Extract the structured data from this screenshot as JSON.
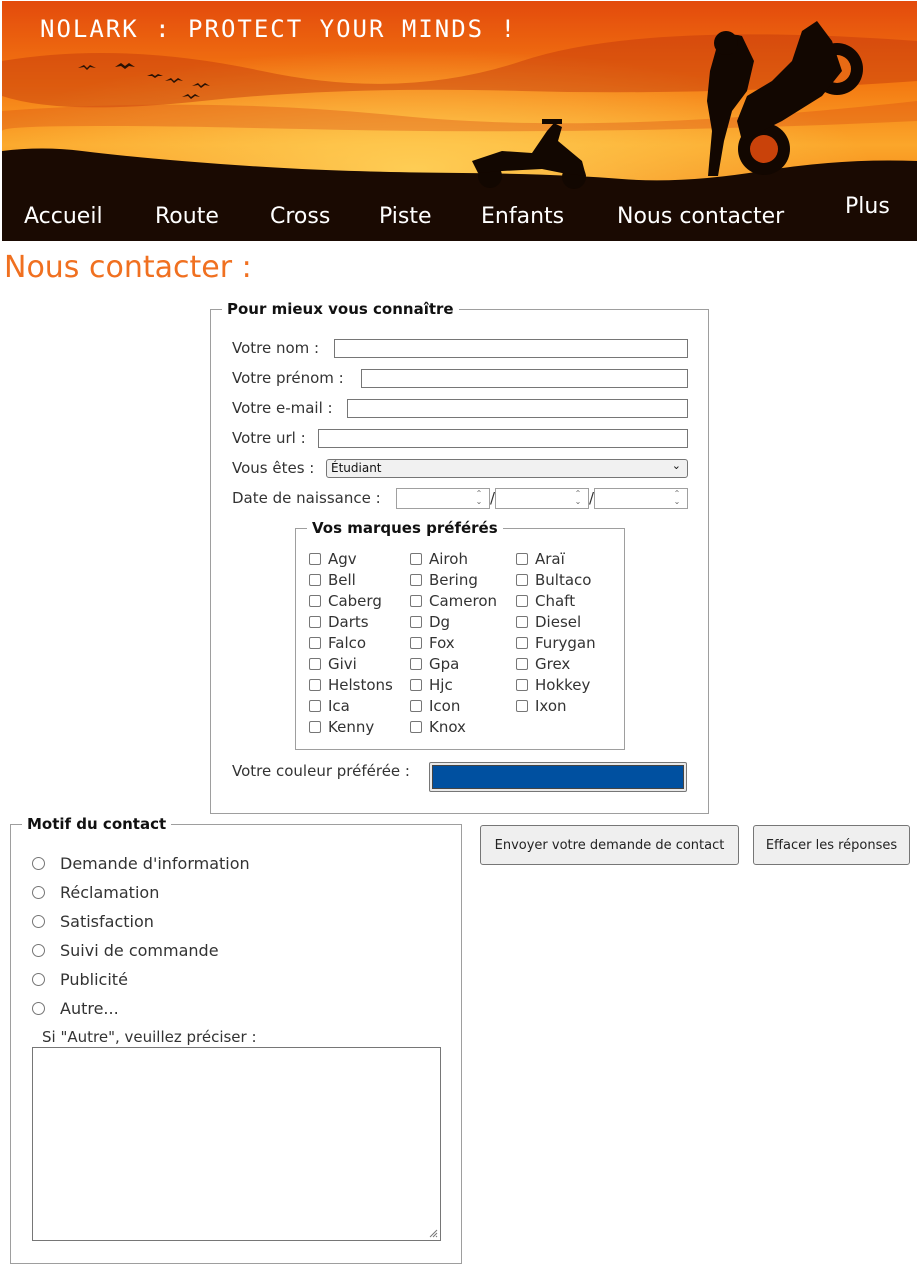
{
  "header": {
    "site_title": "NOLARK : PROTECT YOUR MINDS !",
    "nav": [
      {
        "label": "Accueil"
      },
      {
        "label": "Route"
      },
      {
        "label": "Cross"
      },
      {
        "label": "Piste"
      },
      {
        "label": "Enfants"
      },
      {
        "label": "Nous contacter"
      },
      {
        "label": "Plus"
      }
    ]
  },
  "page": {
    "title": "Nous contacter :"
  },
  "about": {
    "legend": "Pour mieux vous connaître",
    "nom_label": "Votre nom :",
    "prenom_label": "Votre prénom :",
    "email_label": "Votre e-mail :",
    "url_label": "Votre url :",
    "status_label": "Vous êtes :",
    "status_value": "Étudiant",
    "birth_label": "Date de naissance :",
    "date_separator": "/",
    "color_label": "Votre couleur préférée :",
    "color_value": "#0050a0"
  },
  "brands": {
    "legend": "Vos marques préférés",
    "items": [
      "Agv",
      "Airoh",
      "Araï",
      "Bell",
      "Bering",
      "Bultaco",
      "Caberg",
      "Cameron",
      "Chaft",
      "Darts",
      "Dg",
      "Diesel",
      "Falco",
      "Fox",
      "Furygan",
      "Givi",
      "Gpa",
      "Grex",
      "Helstons",
      "Hjc",
      "Hokkey",
      "Ica",
      "Icon",
      "Ixon",
      "Kenny",
      "Knox"
    ]
  },
  "motif": {
    "legend": "Motif du contact",
    "options": [
      "Demande d'information",
      "Réclamation",
      "Satisfaction",
      "Suivi de commande",
      "Publicité",
      "Autre..."
    ],
    "other_label": "Si \"Autre\", veuillez préciser :"
  },
  "buttons": {
    "submit": "Envoyer votre demande de contact",
    "reset": "Effacer les réponses"
  },
  "colors": {
    "accent": "#f07020",
    "nav_bg": "#000000",
    "picked": "#0050a0"
  }
}
